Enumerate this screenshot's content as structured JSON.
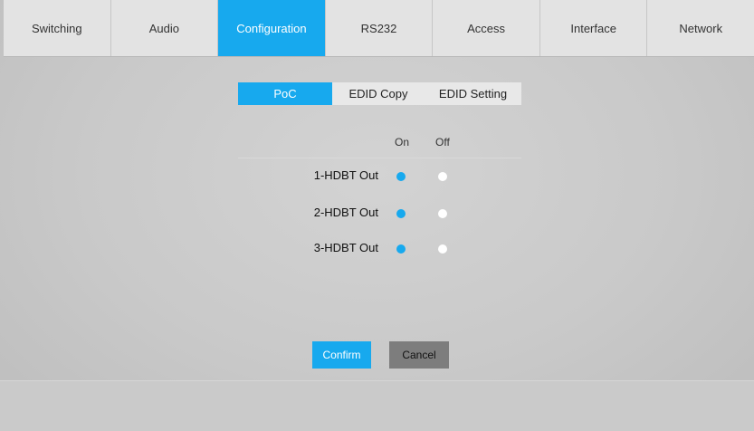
{
  "nav": {
    "tabs": [
      {
        "label": "Switching"
      },
      {
        "label": "Audio"
      },
      {
        "label": "Configuration"
      },
      {
        "label": "RS232"
      },
      {
        "label": "Access"
      },
      {
        "label": "Interface"
      },
      {
        "label": "Network"
      }
    ],
    "active_tab": "Configuration"
  },
  "subtabs": {
    "items": [
      {
        "label": "PoC"
      },
      {
        "label": "EDID Copy"
      },
      {
        "label": "EDID Setting"
      }
    ],
    "active": "PoC"
  },
  "poc": {
    "col_on": "On",
    "col_off": "Off",
    "rows": [
      {
        "label": "1-HDBT Out",
        "selected": "On"
      },
      {
        "label": "2-HDBT Out",
        "selected": "On"
      },
      {
        "label": "3-HDBT Out",
        "selected": "On"
      }
    ]
  },
  "actions": {
    "confirm_label": "Confirm",
    "cancel_label": "Cancel"
  },
  "colors": {
    "accent": "#17a9ee",
    "cancel_button": "#7d7d7d",
    "background": "#cccccc"
  }
}
